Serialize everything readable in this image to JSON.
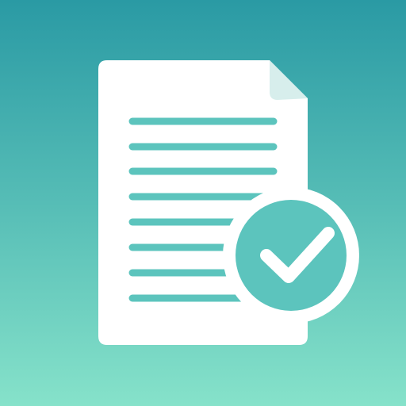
{
  "icon": {
    "name": "document-check-app-icon",
    "glyphs": [
      "document-icon",
      "checkmark-badge-icon"
    ]
  },
  "colors": {
    "background_top": "#2A9AA4",
    "background_mid": "#56BDB6",
    "background_bottom": "#86E2CA",
    "paper": "#FFFFFF",
    "fold_shadow": "#D7EEEC",
    "text_lines": "#5CC4BD",
    "badge_fill": "#5CC4BD",
    "badge_ring": "#FFFFFF",
    "checkmark": "#FFFFFF"
  },
  "document": {
    "line_count": 8
  }
}
